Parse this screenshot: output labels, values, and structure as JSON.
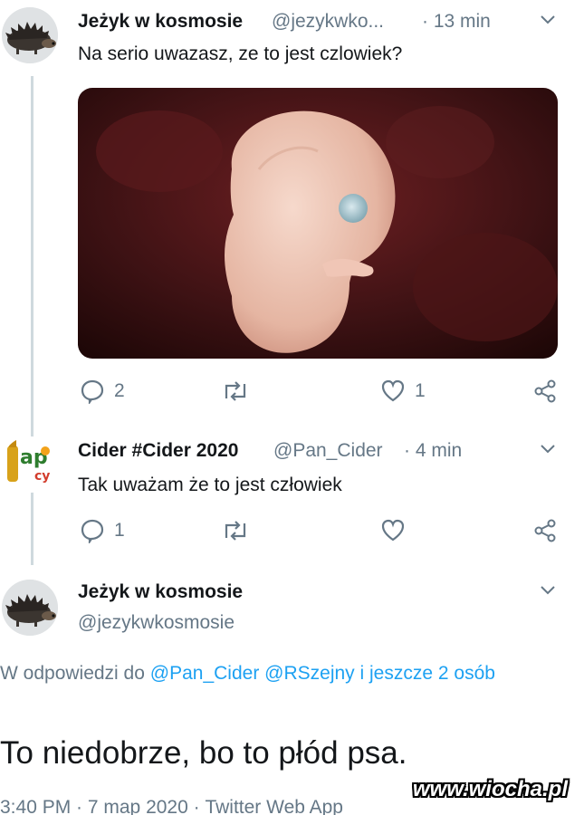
{
  "tweets": [
    {
      "name": "Jeżyk w kosmosie",
      "handle": "@jezykwko...",
      "time": "· 13 min",
      "text": "Na serio uwazasz, ze to jest czlowiek?",
      "image": "embryo-photo",
      "replies": "2",
      "retweets": "",
      "likes": "1"
    },
    {
      "name": "Cider #Cider 2020",
      "handle": "@Pan_Cider",
      "time": "· 4 min",
      "text": "Tak uważam że to jest człowiek",
      "replies": "1",
      "retweets": "",
      "likes": ""
    }
  ],
  "main_tweet": {
    "name": "Jeżyk w kosmosie",
    "handle": "@jezykwkosmosie",
    "reply_prefix": "W odpowiedzi do",
    "mention1": "@Pan_Cider",
    "mention2": "@RSzejny",
    "reply_suffix": "i jeszcze 2 osób",
    "text": "To niedobrze, bo to płód psa.",
    "meta": "3:40 PM · 7 maр 2020 · Twitter Web App"
  },
  "watermark": "www.wiocha.pl",
  "colors": {
    "accent": "#1da1f2",
    "secondary_text": "#657786",
    "thread_line": "#cfd9de"
  },
  "icons": [
    "reply-icon",
    "retweet-icon",
    "like-icon",
    "share-icon",
    "chevron-down-icon"
  ]
}
